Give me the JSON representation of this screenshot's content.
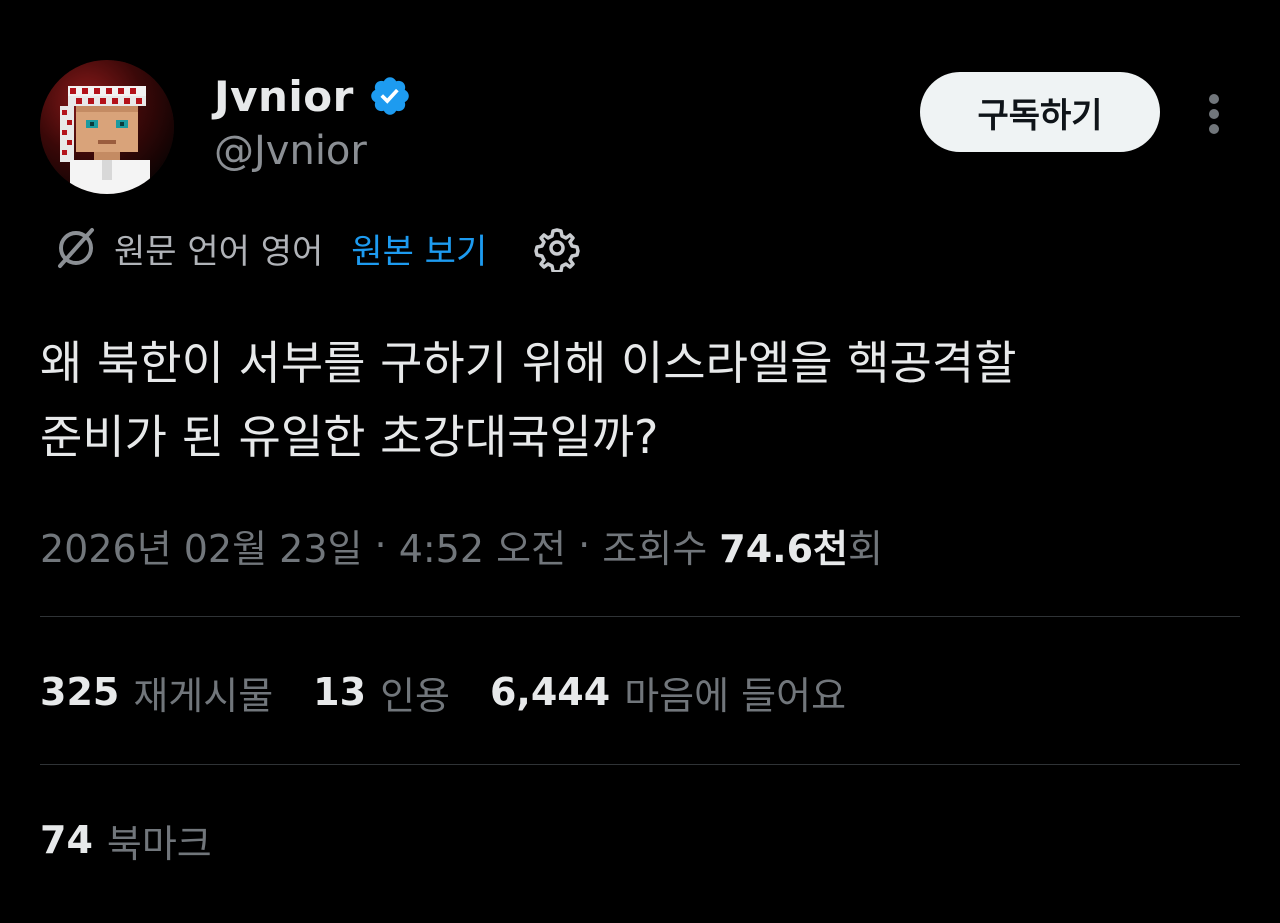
{
  "author": {
    "display_name": "Jvnior",
    "handle": "@Jvnior",
    "verified": true
  },
  "subscribe_button": {
    "label": "구독하기"
  },
  "translation": {
    "source_label": "원문 언어 영어",
    "view_original_label": "원본 보기"
  },
  "tweet": {
    "text": "왜 북한이 서부를 구하기 위해 이스라엘을 핵공격할\n준비가 된 유일한 초강대국일까?"
  },
  "meta": {
    "date": "2026년 02월 23일",
    "separator": " · ",
    "time": "4:52 오전",
    "views_label": "조회수 ",
    "views_count": "74.6천",
    "views_suffix": "회"
  },
  "stats": {
    "reposts_count": "325",
    "reposts_label": "재게시물",
    "quotes_count": "13",
    "quotes_label": "인용",
    "likes_count": "6,444",
    "likes_label": "마음에 들어요",
    "bookmarks_count": "74",
    "bookmarks_label": "북마크"
  },
  "colors": {
    "background": "#000000",
    "text_primary": "#e7e9ea",
    "text_secondary": "#71767b",
    "accent_blue": "#1d9bf0",
    "divider": "#2f3336",
    "button_bg": "#eff3f4"
  },
  "icons": {
    "verified": "verified-badge-icon",
    "translate": "translate-icon",
    "settings": "gear-icon",
    "more": "more-icon"
  }
}
